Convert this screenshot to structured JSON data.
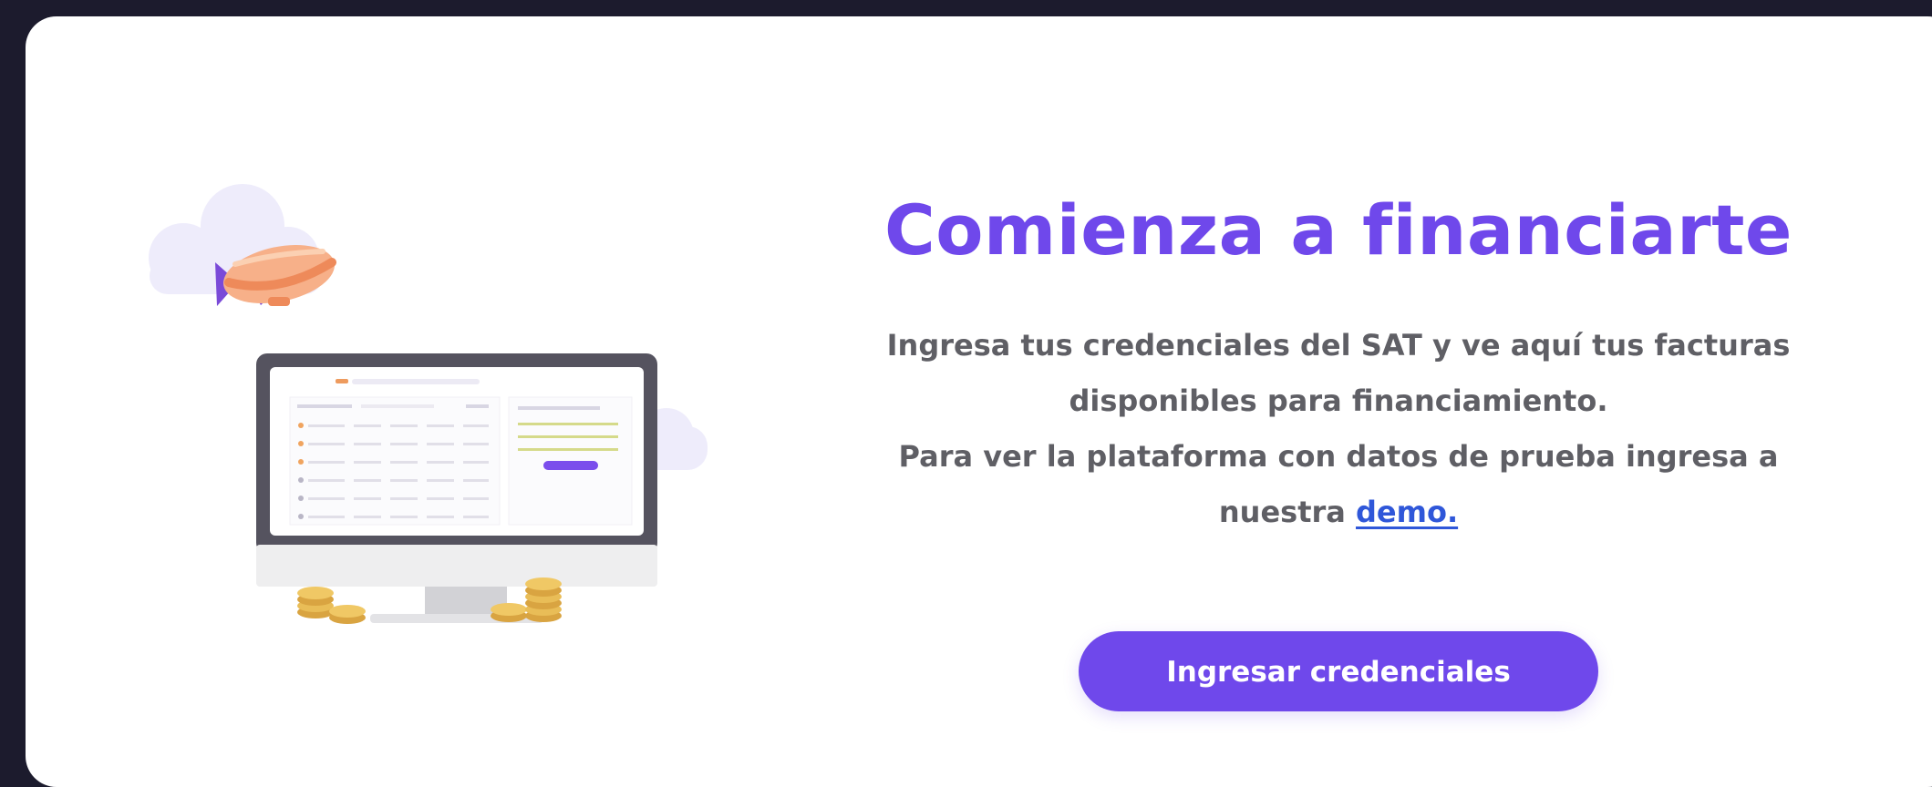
{
  "main": {
    "title": "Comienza a financiarte",
    "description_line1": "Ingresa tus credenciales del SAT y ve aquí tus facturas",
    "description_line2": "disponibles para financiamiento.",
    "description_line3": "Para ver la plataforma con datos de prueba ingresa a",
    "description_line4_prefix": "nuestra",
    "demo_link_label": "demo.",
    "cta_label": "Ingresar credenciales"
  },
  "colors": {
    "background": "#1c1b2d",
    "card": "#ffffff",
    "accent": "#6f48eb",
    "link": "#2f57d9",
    "body_text": "#5f5f65"
  },
  "illustration": {
    "icons": [
      "cloud-icon",
      "blimp-icon",
      "monitor-icon",
      "coin-stack-icon"
    ]
  }
}
